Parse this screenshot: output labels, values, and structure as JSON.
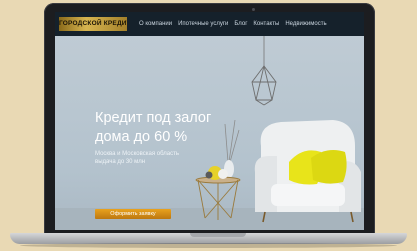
{
  "site": {
    "logo_text": "ГОРОДСКОЙ КРЕДИТ",
    "nav": [
      {
        "label": "О компании"
      },
      {
        "label": "Ипотечные услуги"
      },
      {
        "label": "Блог"
      },
      {
        "label": "Контакты"
      },
      {
        "label": "Недвижимость"
      }
    ]
  },
  "hero": {
    "title_line1": "Кредит под залог",
    "title_line2": "дома до 60 %",
    "subtitle_line1": "Москва и Московская область",
    "subtitle_line2": "выдача до 30 млн",
    "cta_label": "Оформить заявку"
  },
  "colors": {
    "header_bg": "#15212b",
    "hero_bg": "#b9c7d2",
    "accent": "#e0a020",
    "pillow": "#e8e41a"
  }
}
